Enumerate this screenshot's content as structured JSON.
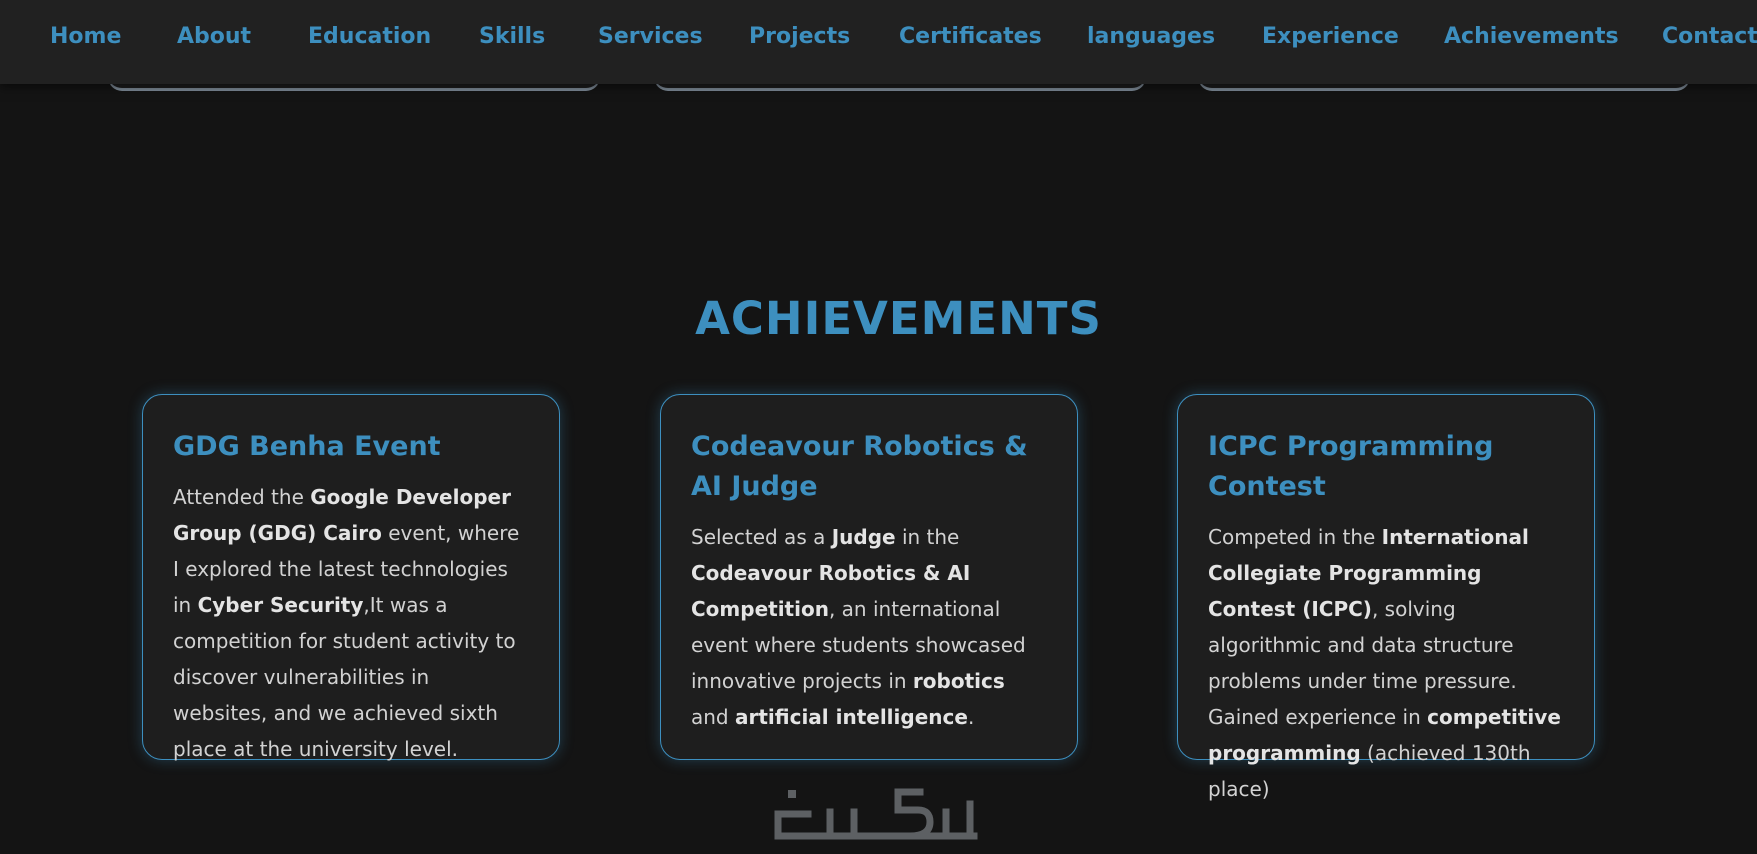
{
  "nav": {
    "items": [
      {
        "label": "Home"
      },
      {
        "label": "About"
      },
      {
        "label": "Education"
      },
      {
        "label": "Skills"
      },
      {
        "label": "Services"
      },
      {
        "label": "Projects"
      },
      {
        "label": "Certificates"
      },
      {
        "label": "languages"
      },
      {
        "label": "Experience"
      },
      {
        "label": "Achievements"
      },
      {
        "label": "Contact"
      }
    ]
  },
  "achievements": {
    "title": "ACHIEVEMENTS",
    "cards": [
      {
        "title": "GDG Benha Event",
        "parts": [
          "Attended the ",
          "Google Developer Group (GDG) Cairo",
          " event, where I explored the latest technologies in ",
          "Cyber Security",
          ",It was a competition for student activity to discover vulnerabilities in websites, and we achieved sixth place at the university level."
        ]
      },
      {
        "title": "Codeavour Robotics & AI Judge",
        "parts": [
          "Selected as a ",
          "Judge",
          " in the ",
          "Codeavour Robotics & AI Competition",
          ", an international event where students showcased innovative projects in ",
          "robotics",
          " and ",
          "artificial intelligence",
          "."
        ]
      },
      {
        "title": "ICPC Programming Contest",
        "parts": [
          "Competed in the ",
          "International Collegiate Programming Contest (ICPC)",
          ", solving algorithmic and data structure problems under time pressure. Gained experience in ",
          "competitive programming",
          " (achieved 130th place)"
        ]
      }
    ]
  },
  "footer": {
    "logo_text": "خمسات",
    "logo_icon": "khamsat-logo"
  },
  "colors": {
    "accent": "#3d8fbf",
    "background": "#141414",
    "card": "#1e1e1e",
    "navbar": "#212121",
    "text": "#d2d2d2"
  }
}
